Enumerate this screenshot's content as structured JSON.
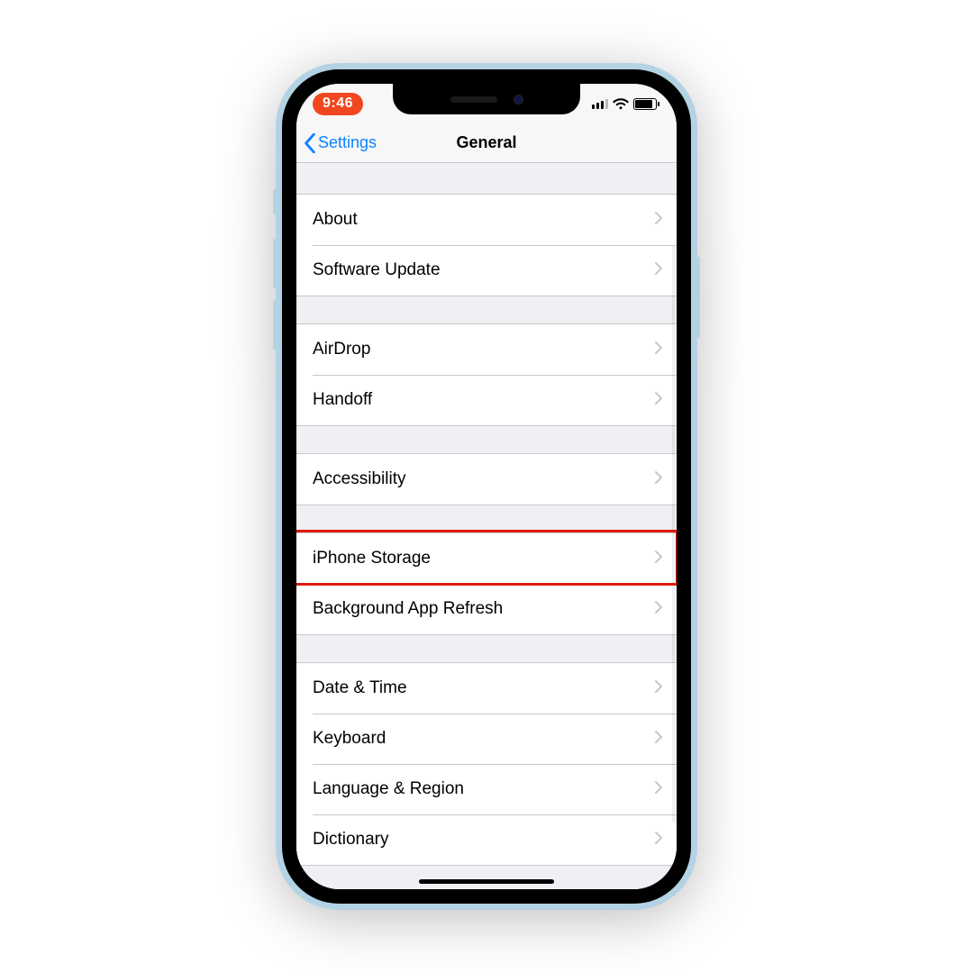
{
  "status": {
    "time": "9:46"
  },
  "nav": {
    "back_label": "Settings",
    "title": "General"
  },
  "groups": [
    {
      "rows": [
        {
          "id": "about",
          "label": "About"
        },
        {
          "id": "software-update",
          "label": "Software Update"
        }
      ]
    },
    {
      "rows": [
        {
          "id": "airdrop",
          "label": "AirDrop"
        },
        {
          "id": "handoff",
          "label": "Handoff"
        }
      ]
    },
    {
      "rows": [
        {
          "id": "accessibility",
          "label": "Accessibility"
        }
      ]
    },
    {
      "rows": [
        {
          "id": "iphone-storage",
          "label": "iPhone Storage",
          "highlight": true
        },
        {
          "id": "background-app-refresh",
          "label": "Background App Refresh"
        }
      ]
    },
    {
      "rows": [
        {
          "id": "date-time",
          "label": "Date & Time"
        },
        {
          "id": "keyboard",
          "label": "Keyboard"
        },
        {
          "id": "language-region",
          "label": "Language & Region"
        },
        {
          "id": "dictionary",
          "label": "Dictionary"
        }
      ]
    }
  ]
}
